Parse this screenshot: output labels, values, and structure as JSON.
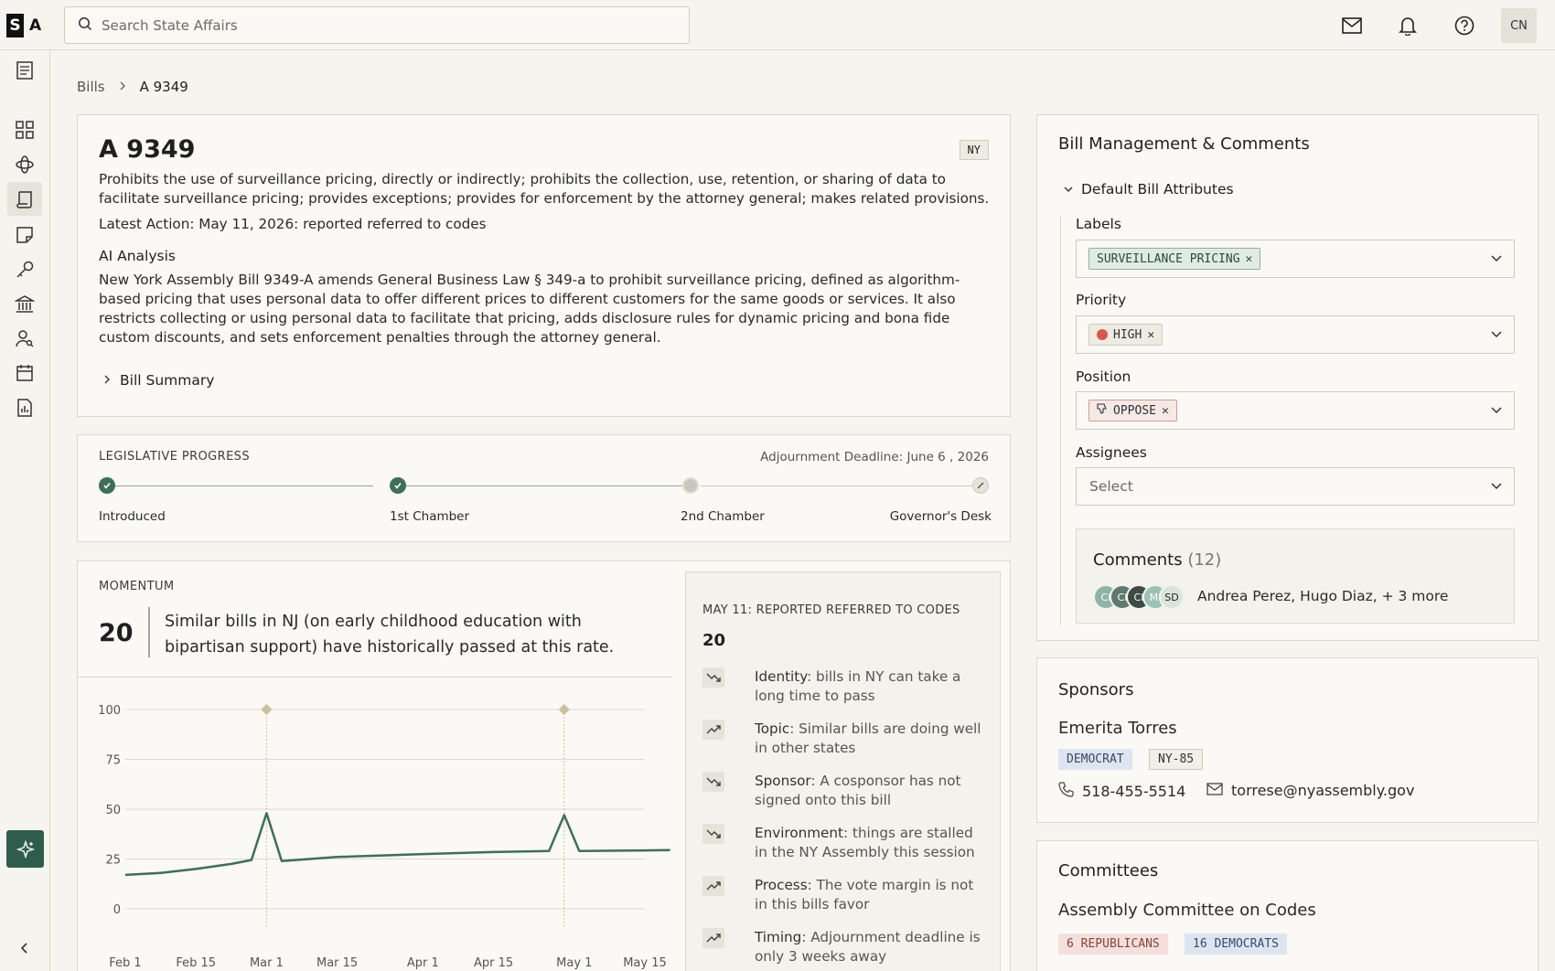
{
  "topbar": {
    "logo_left": "S",
    "logo_right": "A",
    "search_placeholder": "Search State Affairs",
    "avatar_initials": "CN"
  },
  "breadcrumb": {
    "parent": "Bills",
    "current": "A 9349"
  },
  "bill": {
    "id": "A 9349",
    "state": "NY",
    "description": "Prohibits the use of surveillance pricing, directly or indirectly; prohibits the collection, use, retention, or sharing of data to facilitate surveillance pricing; provides exceptions; provides for enforcement by the attorney general; makes related provisions.",
    "latest_action": "Latest Action: May 11, 2026: reported referred to codes",
    "ai_heading": "AI Analysis",
    "ai_text": "New York Assembly Bill 9349-A amends General Business Law § 349-a to prohibit surveillance pricing, defined as algorithm-based pricing that uses personal data to offer different prices to different customers for the same goods or services. It also restricts collecting or using personal data to facilitate that pricing, adds disclosure rules for dynamic pricing and bona fide custom discounts, and sets enforcement penalties through the attorney general.",
    "summary_toggle": "Bill Summary"
  },
  "progress": {
    "label": "LEGISLATIVE PROGRESS",
    "deadline": "Adjournment Deadline: June 6 , 2026",
    "stages": [
      {
        "label": "Introduced",
        "status": "done"
      },
      {
        "label": "1st Chamber",
        "status": "done"
      },
      {
        "label": "2nd Chamber",
        "status": "pending"
      },
      {
        "label": "Governor's Desk",
        "status": "future"
      }
    ]
  },
  "momentum": {
    "label": "MOMENTUM",
    "score": "20",
    "text": "Similar bills in NJ (on early childhood education with bipartisan support) have historically passed at this rate.",
    "reasons_heading": "MAY 11: REPORTED REFERRED TO CODES",
    "reasons_score": "20",
    "reasons": [
      {
        "trend": "down",
        "title": "Identity",
        "text": ": bills in NY can take a long time to pass"
      },
      {
        "trend": "up",
        "title": "Topic",
        "text": ": Similar bills are doing well in other states"
      },
      {
        "trend": "down",
        "title": "Sponsor",
        "text": ": A cosponsor has not signed onto this bill"
      },
      {
        "trend": "down",
        "title": "Environment",
        "text": ": things are stalled in the NY Assembly this session"
      },
      {
        "trend": "up",
        "title": "Process",
        "text": ": The vote margin is not in this bills favor"
      },
      {
        "trend": "up",
        "title": "Timing",
        "text": ": Adjournment deadline is only 3 weeks away"
      }
    ]
  },
  "chart_data": {
    "type": "line",
    "title": "",
    "xlabel": "",
    "ylabel": "",
    "ylim": [
      0,
      100
    ],
    "yticks": [
      0,
      25,
      50,
      75,
      100
    ],
    "xticks": [
      "Feb 1",
      "Feb 15",
      "Mar 1",
      "Mar 15",
      "Apr 1",
      "Apr 15",
      "May 1",
      "May 15"
    ],
    "series": [
      {
        "color": "#3f6e5a",
        "x": [
          "Feb 1",
          "Feb 8",
          "Feb 15",
          "Feb 22",
          "Feb 26",
          "Mar 1",
          "Mar 4",
          "Mar 15",
          "Apr 1",
          "Apr 15",
          "Apr 26",
          "Apr 29",
          "May 2",
          "May 15",
          "May 20"
        ],
        "values": [
          17,
          18,
          20,
          22.5,
          24.5,
          48,
          24,
          26,
          27.5,
          28.5,
          29,
          47,
          29,
          29.3,
          29.5
        ]
      }
    ],
    "markers": [
      {
        "x": "Mar 1",
        "y": 100
      },
      {
        "x": "Apr 29",
        "y": 100
      }
    ],
    "grid": true
  },
  "management": {
    "title": "Bill Management & Comments",
    "section": "Default Bill Attributes",
    "labels_label": "Labels",
    "label_chip": "SURVEILLANCE PRICING",
    "priority_label": "Priority",
    "priority_chip": "HIGH",
    "priority_color": "#d9584a",
    "position_label": "Position",
    "position_chip": "OPPOSE",
    "assignees_label": "Assignees",
    "assignees_placeholder": "Select",
    "comments_title": "Comments",
    "comments_count": "(12)",
    "avatars": [
      {
        "initials": "CI",
        "color": "#8fb3a4"
      },
      {
        "initials": "CI",
        "color": "#5f7a70"
      },
      {
        "initials": "CI",
        "color": "#3e4a46"
      },
      {
        "initials": "MI",
        "color": "#9bc2b3"
      },
      {
        "initials": "SD",
        "color": "#dbe4dc"
      }
    ],
    "commenters": "Andrea Perez, Hugo Diaz, + 3 more"
  },
  "sponsors": {
    "title": "Sponsors",
    "name": "Emerita Torres",
    "party": "DEMOCRAT",
    "district": "NY-85",
    "phone": "518-455-5514",
    "email": "torrese@nyassembly.gov"
  },
  "committees": {
    "title": "Committees",
    "name": "Assembly Committee on Codes",
    "republicans": "6 REPUBLICANS",
    "democrats": "16 DEMOCRATS"
  }
}
